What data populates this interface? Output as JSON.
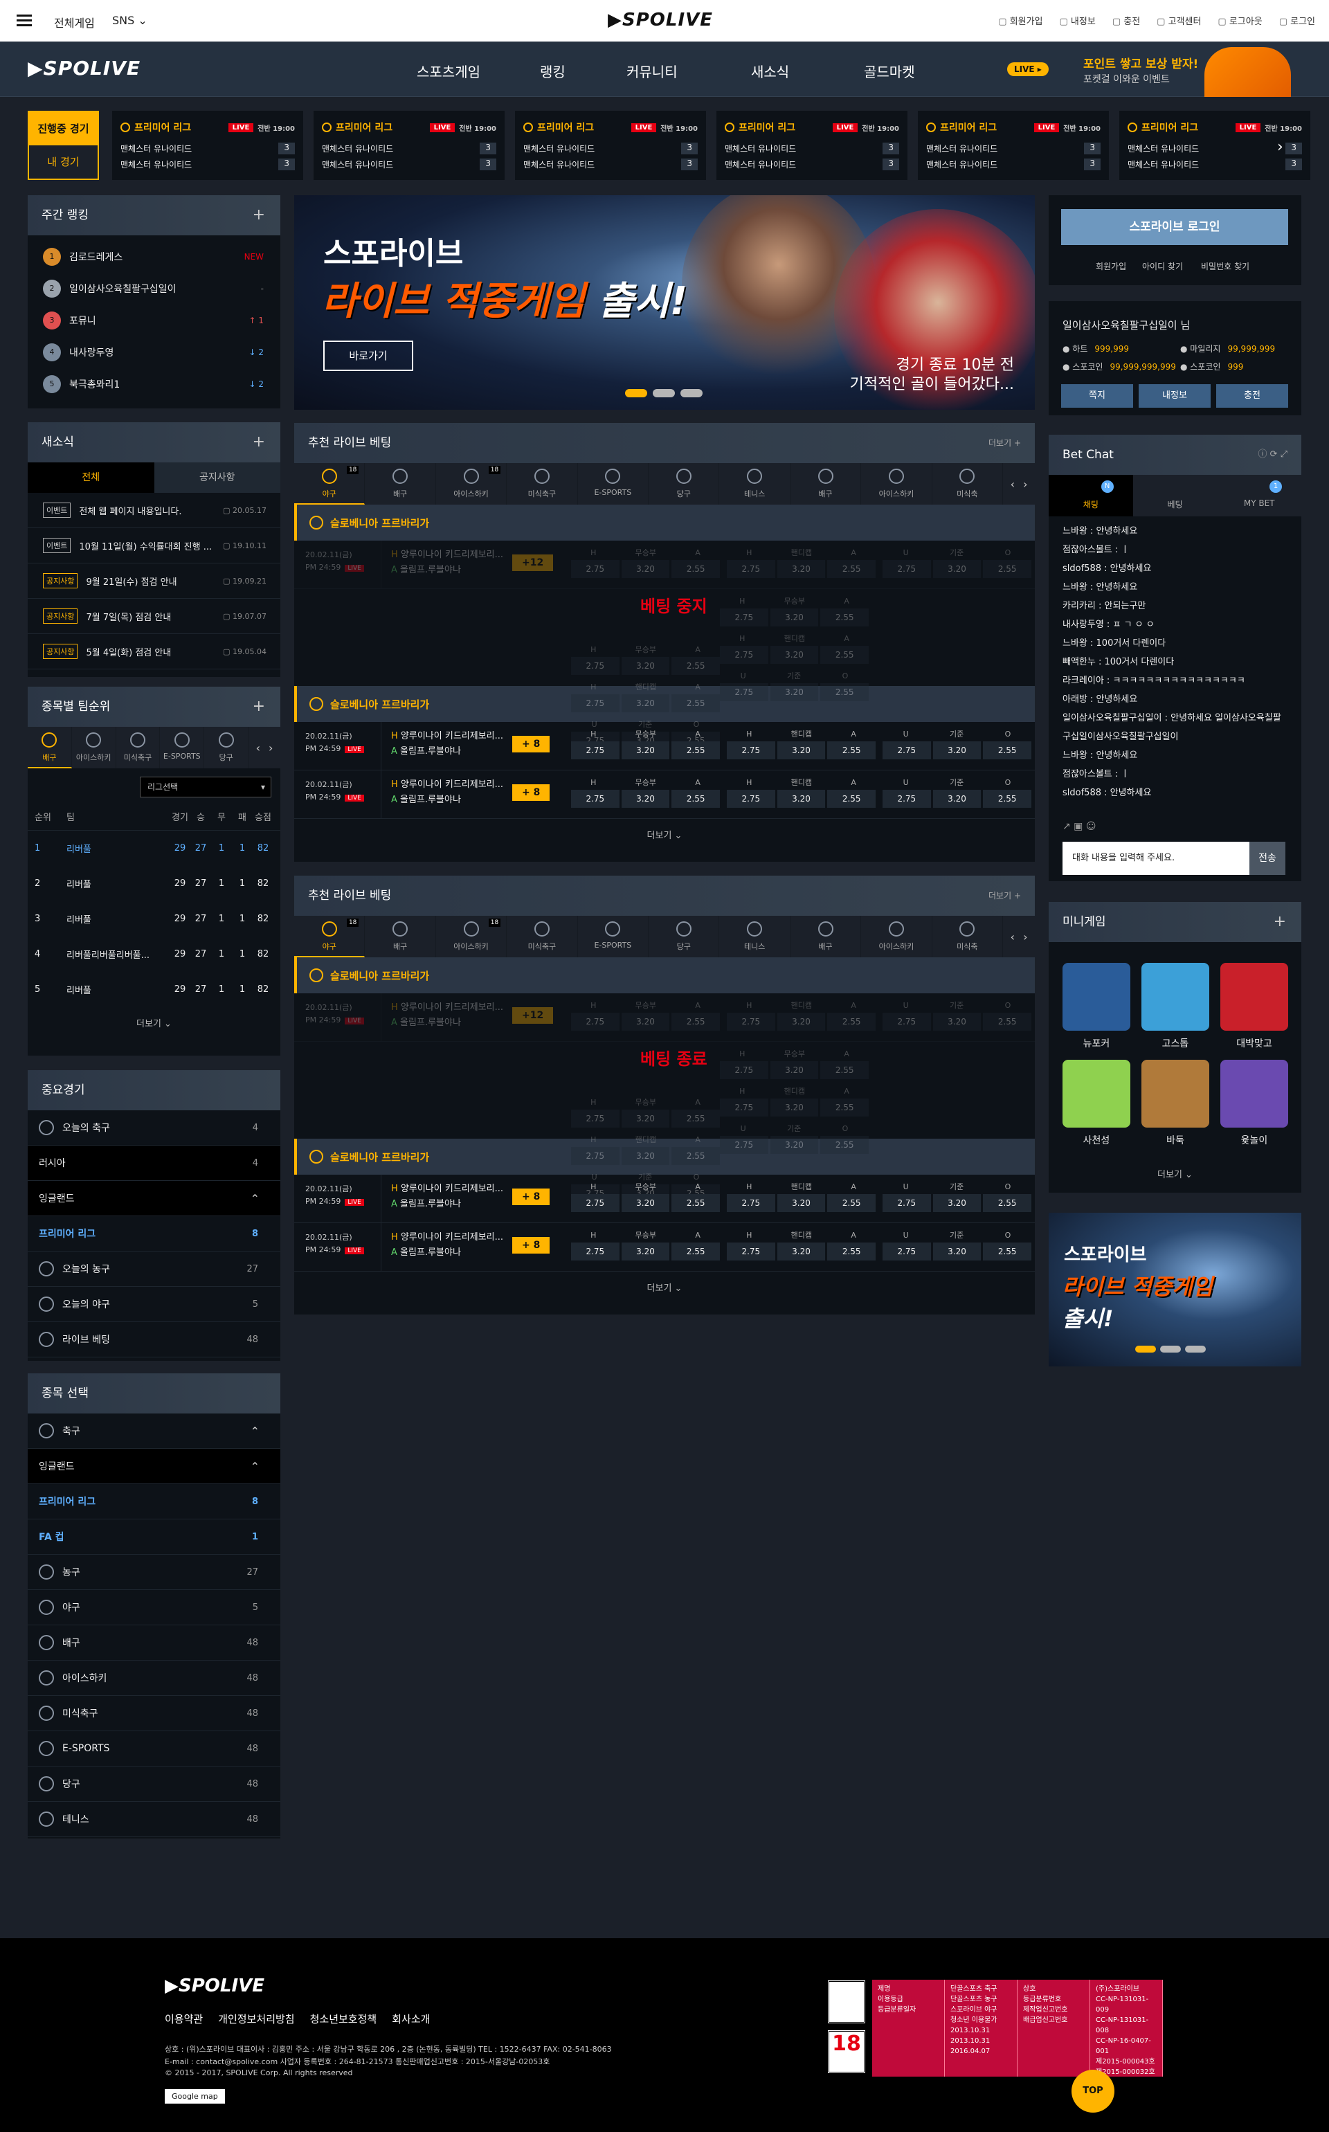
{
  "topbar": {
    "all_games": "전체게임",
    "sns": "SNS",
    "logo": "SPOLIVE",
    "links": [
      "회원가입",
      "내정보",
      "충전",
      "고객센터",
      "로그아웃",
      "로그인"
    ]
  },
  "nav": {
    "logo": "SPOLIVE",
    "items": [
      "스포츠게임",
      "랭킹",
      "커뮤니티",
      "새소식",
      "골드마켓"
    ],
    "promo_badge": "LIVE",
    "promo_title": "포인트 쌓고 보상 받자!",
    "promo_sub": "포켓걸 이와운 이벤트"
  },
  "live": {
    "tab_active": "진행중 경기",
    "tab_mine": "내 경기",
    "cards": [
      {
        "league": "프리미어 리그",
        "badge": "LIVE",
        "time": "전반 19:00",
        "team1": "맨체스터 유나이티드",
        "team2": "맨체스터 유나이티드",
        "s1": "3",
        "s2": "3"
      },
      {
        "league": "프리미어 리그",
        "badge": "LIVE",
        "time": "전반 19:00",
        "team1": "맨체스터 유나이티드",
        "team2": "맨체스터 유나이티드",
        "s1": "3",
        "s2": "3"
      },
      {
        "league": "프리미어 리그",
        "badge": "LIVE",
        "time": "전반 19:00",
        "team1": "맨체스터 유나이티드",
        "team2": "맨체스터 유나이티드",
        "s1": "3",
        "s2": "3"
      },
      {
        "league": "프리미어 리그",
        "badge": "LIVE",
        "time": "전반 19:00",
        "team1": "맨체스터 유나이티드",
        "team2": "맨체스터 유나이티드",
        "s1": "3",
        "s2": "3"
      },
      {
        "league": "프리미어 리그",
        "badge": "LIVE",
        "time": "전반 19:00",
        "team1": "맨체스터 유나이티드",
        "team2": "맨체스터 유나이티드",
        "s1": "3",
        "s2": "3"
      },
      {
        "league": "프리미어 리그",
        "badge": "LIVE",
        "time": "전반 19:00",
        "team1": "맨체스터 유나이티드",
        "team2": "맨체스터 유나이티드",
        "s1": "3",
        "s2": "3"
      }
    ]
  },
  "ranking": {
    "title": "주간 랭킹",
    "rows": [
      {
        "rank": "1",
        "name": "김로드레게스",
        "change": "NEW",
        "color": "#d98b2a"
      },
      {
        "rank": "2",
        "name": "일이삼사오육칠팔구십일이",
        "change": "-",
        "color": "#9aa3ad"
      },
      {
        "rank": "3",
        "name": "포뮤니",
        "change": "↑ 1",
        "color": "#e05050"
      },
      {
        "rank": "4",
        "name": "내사랑두영",
        "change": "↓ 2",
        "color": "#7a8a9c"
      },
      {
        "rank": "5",
        "name": "북극총뫄리1",
        "change": "↓ 2",
        "color": "#7a8a9c"
      }
    ]
  },
  "news": {
    "title": "새소식",
    "tab_all": "전체",
    "tab_notice": "공지사항",
    "rows": [
      {
        "tag": "이벤트",
        "text": "전체 웹 페이지 내용입니다.",
        "date": "20.05.17"
      },
      {
        "tag": "이벤트",
        "text": "10월 11일(월) 수익률대회 진행 ...",
        "date": "19.10.11"
      },
      {
        "tag": "공지사항",
        "text": "9월 21일(수) 점검 안내",
        "date": "19.09.21"
      },
      {
        "tag": "공지사항",
        "text": "7월 7일(목) 점검 안내",
        "date": "19.07.07"
      },
      {
        "tag": "공지사항",
        "text": "5월 4일(화) 점검 안내",
        "date": "19.05.04"
      }
    ]
  },
  "teamrank": {
    "title": "종목별 팀순위",
    "tabs": [
      "배구",
      "아이스하키",
      "미식축구",
      "E-SPORTS",
      "당구"
    ],
    "league_select": "리그선택",
    "headers": [
      "순위",
      "팀",
      "경기",
      "승",
      "무",
      "패",
      "승점"
    ],
    "rows": [
      [
        "1",
        "리버풀",
        "29",
        "27",
        "1",
        "1",
        "82"
      ],
      [
        "2",
        "리버풀",
        "29",
        "27",
        "1",
        "1",
        "82"
      ],
      [
        "3",
        "리버풀",
        "29",
        "27",
        "1",
        "1",
        "82"
      ],
      [
        "4",
        "리버풀리버풀리버풀...",
        "29",
        "27",
        "1",
        "1",
        "82"
      ],
      [
        "5",
        "리버풀",
        "29",
        "27",
        "1",
        "1",
        "82"
      ]
    ],
    "more": "더보기"
  },
  "important": {
    "title": "중요경기",
    "rows": [
      {
        "label": "오늘의 축구",
        "num": "4"
      },
      {
        "label": "러시아",
        "num": "4"
      },
      {
        "label": "잉글랜드",
        "num": ""
      },
      {
        "label": "프리미어 리그",
        "num": "8"
      },
      {
        "label": "오늘의 농구",
        "num": "27"
      },
      {
        "label": "오늘의 야구",
        "num": "5"
      },
      {
        "label": "라이브 베팅",
        "num": "48"
      }
    ]
  },
  "sportsel": {
    "title": "종목 선택",
    "rows": [
      {
        "label": "축구",
        "num": ""
      },
      {
        "label": "잉글랜드",
        "num": ""
      },
      {
        "label": "프리미어 리그",
        "num": "8"
      },
      {
        "label": "FA 컵",
        "num": "1"
      },
      {
        "label": "농구",
        "num": "27"
      },
      {
        "label": "야구",
        "num": "5"
      },
      {
        "label": "배구",
        "num": "48"
      },
      {
        "label": "아이스하키",
        "num": "48"
      },
      {
        "label": "미식축구",
        "num": "48"
      },
      {
        "label": "E-SPORTS",
        "num": "48"
      },
      {
        "label": "당구",
        "num": "48"
      },
      {
        "label": "테니스",
        "num": "48"
      }
    ]
  },
  "banner": {
    "line1": "스포라이브",
    "line2a": "라이브 적중게임",
    "line2b": "출시!",
    "button": "바로가기",
    "caption1": "경기 종료 10분 전",
    "caption2": "기적적인 골이 들어갔다..."
  },
  "bet": {
    "title": "추천 라이브 베팅",
    "more": "더보기",
    "tabs": [
      {
        "label": "야구",
        "cnt": "18"
      },
      {
        "label": "배구",
        "cnt": ""
      },
      {
        "label": "아이스하키",
        "cnt": "18"
      },
      {
        "label": "미식축구",
        "cnt": ""
      },
      {
        "label": "E-SPORTS",
        "cnt": ""
      },
      {
        "label": "당구",
        "cnt": ""
      },
      {
        "label": "테니스",
        "cnt": ""
      },
      {
        "label": "배구",
        "cnt": ""
      },
      {
        "label": "아이스하키",
        "cnt": ""
      },
      {
        "label": "미식축",
        "cnt": ""
      }
    ],
    "league": "슬로베니아 프르바리가",
    "date": "20.02.11(금)",
    "time": "PM 24:59",
    "live": "LIVE",
    "home": "양루이나이 키드리제보리...",
    "away": "올림프.루블야나",
    "h": "H",
    "a": "A",
    "plus_dim": "+12",
    "plus": "+ 8",
    "g1": [
      "H",
      "무승부",
      "A"
    ],
    "g2": [
      "H",
      "핸디캡",
      "A"
    ],
    "g3": [
      "U",
      "기준",
      "O"
    ],
    "v1": [
      "2.75",
      "3.20",
      "2.55"
    ],
    "v2": [
      "2.75",
      "3.20",
      "2.55"
    ],
    "v3": [
      "2.75",
      "3.20",
      "2.55"
    ],
    "stop1": "베팅 중지",
    "stop2": "베팅 종료",
    "more_label": "더보기"
  },
  "login": {
    "button": "스포라이브 로그인",
    "links": [
      "회원가입",
      "아이디 찾기",
      "비밀번호 찾기"
    ]
  },
  "user": {
    "name": "일이삼사오육칠팔구십일이 님",
    "points": [
      {
        "label": "하트",
        "val": "999,999"
      },
      {
        "label": "마일리지",
        "val": "99,999,999"
      },
      {
        "label": "스포코인",
        "val": "99,999,999,999"
      },
      {
        "label": "스포코인",
        "val": "999"
      }
    ],
    "buttons": [
      "쪽지",
      "내정보",
      "충전"
    ]
  },
  "chat": {
    "title": "Bet Chat",
    "tabs": [
      {
        "label": "채팅",
        "badge": "N"
      },
      {
        "label": "베팅",
        "badge": ""
      },
      {
        "label": "MY BET",
        "badge": "1"
      }
    ],
    "messages": [
      "느바왕 : 안녕하세요",
      "점잖아스볼트 : ㅣ",
      "sldof588 : 안녕하세요",
      "느바왕 : 안녕하세요",
      "카리카리 : 안되는구만",
      "내사랑두영 : ㅍ ㄱ ㅇ ㅇ",
      "느바왕 : 100거서 다렌이다",
      "빼액한누 : 100거서 다렌이다",
      "라크레이아 : ㅋㅋㅋㅋㅋㅋㅋㅋㅋㅋㅋㅋㅋㅋㅋㅋ",
      "아래방 : 안녕하세요",
      "일이삼사오육칠팔구십일이 : 안녕하세요 일이삼사오육칠팔구십일이삼사오육칠팔구십일이",
      "느바왕 : 안녕하세요",
      "점잖아스볼트 : ㅣ",
      "sldof588 : 안녕하세요"
    ],
    "placeholder": "대화 내용을 입력해 주세요.",
    "send": "전송"
  },
  "mini": {
    "title": "미니게임",
    "games": [
      "뉴포커",
      "고스톱",
      "대박맞고",
      "사천성",
      "바둑",
      "윷놀이"
    ],
    "more": "더보기"
  },
  "banner2": {
    "line1": "스포라이브",
    "line2": "라이브 적중게임",
    "line3": "출시!"
  },
  "footer": {
    "logo": "SPOLIVE",
    "links": [
      "이용약관",
      "개인정보처리방침",
      "청소년보호정책",
      "회사소개"
    ],
    "addr1": "상호 : (위)스포라이브 대표이사 : 김홍민 주소 : 서울 강남구 학동로 206 , 2층 (논현동, 동륙빌딩) TEL : 1522-6437 FAX: 02-541-8063",
    "addr2": "E-mail : contact@spolive.com 사업자 등록번호 : 264-81-21573 통신판매업신고번호 : 2015-서울강남-02053호",
    "addr3": "© 2015 - 2017, SPOLIVE Corp. All rights reserved",
    "gmap": "Google map",
    "rating_col1": [
      "제명",
      "이용등급",
      "등급분류일자"
    ],
    "rating_col2": [
      "단골스포츠 축구",
      "단골스포츠 농구",
      "스포라이브 야구",
      "청소년 이용불가",
      "2013.10.31",
      "2013.10.31",
      "2016.04.07"
    ],
    "rating_col3": [
      "상호",
      "등급분류번호",
      "제작업신고번호",
      "배급업신고번호"
    ],
    "rating_col4": [
      "(주)스포라이브",
      "CC-NP-131031-009",
      "CC-NP-131031-008",
      "CC-NP-16-0407-001",
      "제2015-000043호",
      "제2015-000032호"
    ],
    "top": "TOP"
  }
}
